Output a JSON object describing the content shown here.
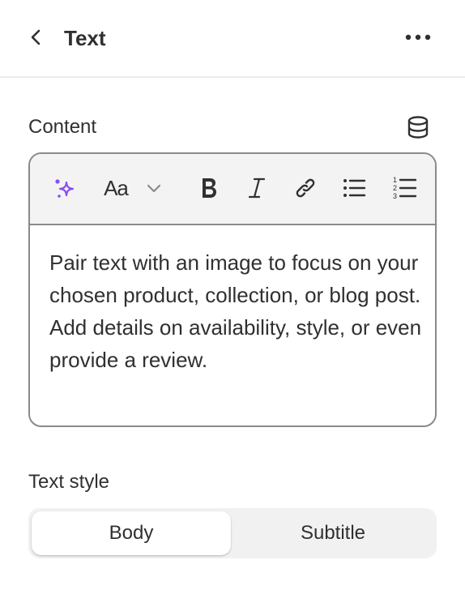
{
  "header": {
    "title": "Text"
  },
  "content": {
    "label": "Content",
    "body": "Pair text with an image to focus on your chosen product, collection, or blog post. Add details on availability, style, or even provide a review."
  },
  "toolbar": {
    "font_size_label": "Aa"
  },
  "text_style": {
    "label": "Text style",
    "options": [
      "Body",
      "Subtitle"
    ],
    "selected": "Body"
  },
  "colors": {
    "ai_accent": "#8a4cf0",
    "border": "#8a8a8a",
    "text": "#303030"
  }
}
